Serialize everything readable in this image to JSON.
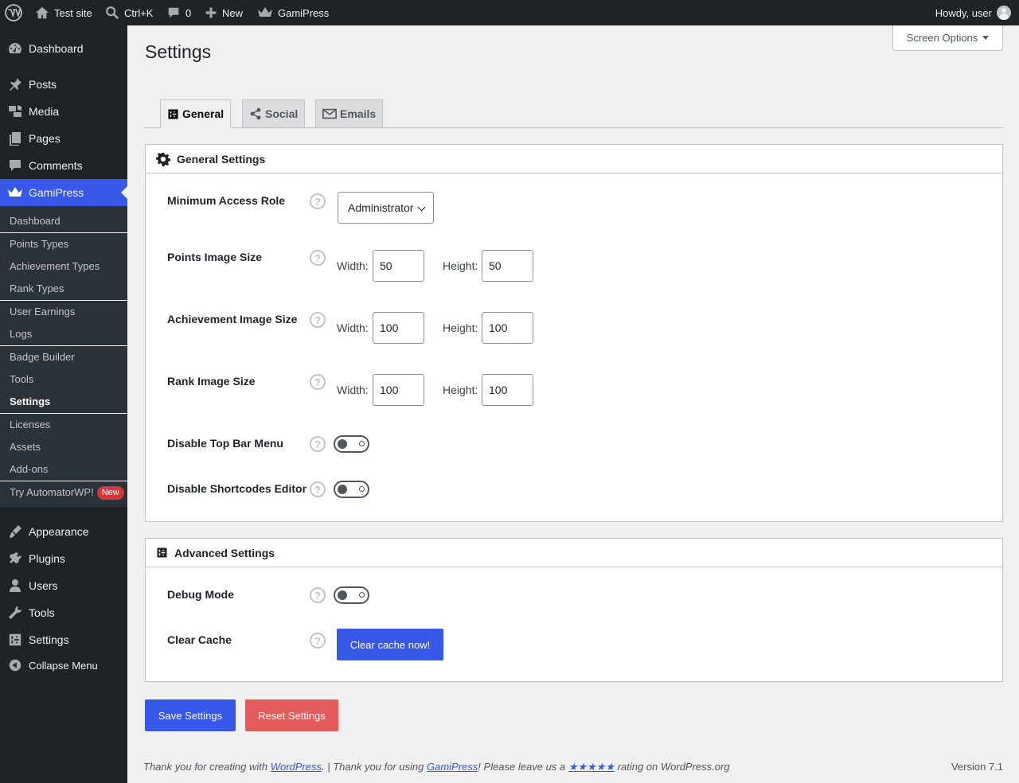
{
  "adminbar": {
    "site_name": "Test site",
    "search_shortcut": "Ctrl+K",
    "comments_count": "0",
    "new_label": "New",
    "plugin_label": "GamiPress",
    "howdy": "Howdy, user"
  },
  "sidebar": {
    "items": [
      {
        "label": "Dashboard",
        "icon": "dashboard-icon"
      },
      {
        "label": "Posts",
        "icon": "pin-icon"
      },
      {
        "label": "Media",
        "icon": "media-icon"
      },
      {
        "label": "Pages",
        "icon": "pages-icon"
      },
      {
        "label": "Comments",
        "icon": "comment-icon"
      },
      {
        "label": "GamiPress",
        "icon": "crown-icon"
      },
      {
        "label": "Appearance",
        "icon": "brush-icon"
      },
      {
        "label": "Plugins",
        "icon": "plug-icon"
      },
      {
        "label": "Users",
        "icon": "user-icon"
      },
      {
        "label": "Tools",
        "icon": "wrench-icon"
      },
      {
        "label": "Settings",
        "icon": "sliders-icon"
      },
      {
        "label": "Collapse Menu",
        "icon": "collapse-icon"
      }
    ],
    "submenu": [
      "Dashboard",
      "Points Types",
      "Achievement Types",
      "Rank Types",
      "User Earnings",
      "Logs",
      "Badge Builder",
      "Tools",
      "Settings",
      "Licenses",
      "Assets",
      "Add-ons",
      "Try AutomatorWP!"
    ],
    "new_badge": "New",
    "colors": {
      "background": "#1d2327",
      "active": "#3858e9",
      "submenu": "#2c3338"
    }
  },
  "page": {
    "title": "Settings",
    "screen_options": "Screen Options"
  },
  "tabs": [
    {
      "label": "General",
      "icon": "sliders-icon",
      "active": true
    },
    {
      "label": "Social",
      "icon": "share-icon",
      "active": false
    },
    {
      "label": "Emails",
      "icon": "email-icon",
      "active": false
    }
  ],
  "general": {
    "title": "General Settings",
    "min_role_label": "Minimum Access Role",
    "min_role_value": "Administrator",
    "width_label": "Width:",
    "height_label": "Height:",
    "points_label": "Points Image Size",
    "points_width": "50",
    "points_height": "50",
    "achievement_label": "Achievement Image Size",
    "achievement_width": "100",
    "achievement_height": "100",
    "rank_label": "Rank Image Size",
    "rank_width": "100",
    "rank_height": "100",
    "topbar_label": "Disable Top Bar Menu",
    "topbar_enabled": false,
    "shortcodes_label": "Disable Shortcodes Editor",
    "shortcodes_enabled": false,
    "help": "?"
  },
  "advanced": {
    "title": "Advanced Settings",
    "debug_label": "Debug Mode",
    "debug_enabled": false,
    "cache_label": "Clear Cache",
    "cache_button": "Clear cache now!"
  },
  "actions": {
    "save": "Save Settings",
    "reset": "Reset Settings"
  },
  "footer": {
    "t1": "Thank you for creating with ",
    "wp_link": "WordPress",
    "t2": ". | Thank you for using ",
    "gp_link": "GamiPress",
    "t3": "! Please leave us a ",
    "stars": "★★★★★",
    "t4": " rating on WordPress.org",
    "version": "Version 7.1"
  }
}
